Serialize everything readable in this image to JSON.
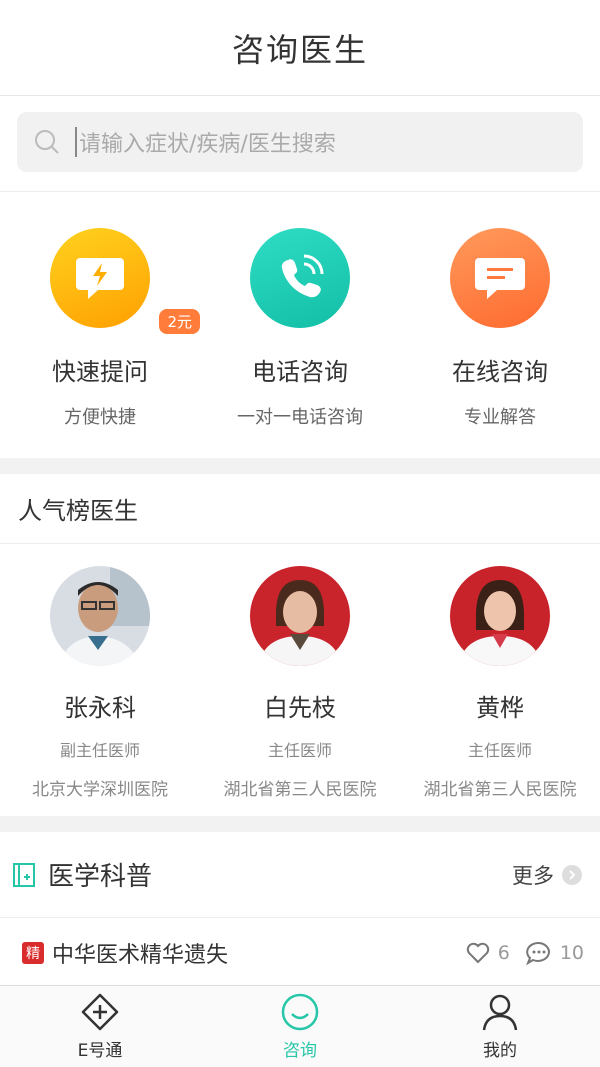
{
  "header": {
    "title": "咨询医生"
  },
  "search": {
    "placeholder": "请输入症状/疾病/医生搜索"
  },
  "services": [
    {
      "name": "快速提问",
      "sub": "方便快捷",
      "badge": "2元",
      "icon": "lightning-chat-icon",
      "color": "#ffb300"
    },
    {
      "name": "电话咨询",
      "sub": "一对一电话咨询",
      "icon": "phone-icon",
      "color": "#1ec9b0"
    },
    {
      "name": "在线咨询",
      "sub": "专业解答",
      "icon": "message-icon",
      "color": "#ff7a3d"
    }
  ],
  "popular": {
    "title": "人气榜医生",
    "doctors": [
      {
        "name": "张永科",
        "title": "副主任医师",
        "hospital": "北京大学深圳医院"
      },
      {
        "name": "白先枝",
        "title": "主任医师",
        "hospital": "湖北省第三人民医院"
      },
      {
        "name": "黄桦",
        "title": "主任医师",
        "hospital": "湖北省第三人民医院"
      }
    ]
  },
  "science": {
    "title": "医学科普",
    "more": "更多",
    "article": {
      "tag": "精",
      "title": "中华医术精华遗失",
      "likes": "6",
      "comments": "10"
    }
  },
  "tabs": [
    {
      "label": "E号通",
      "icon": "plus-diamond-icon"
    },
    {
      "label": "咨询",
      "icon": "smile-chat-icon",
      "active": true
    },
    {
      "label": "我的",
      "icon": "user-icon"
    }
  ],
  "colors": {
    "accent": "#26c6a8",
    "badge": "#ff7c3a"
  }
}
